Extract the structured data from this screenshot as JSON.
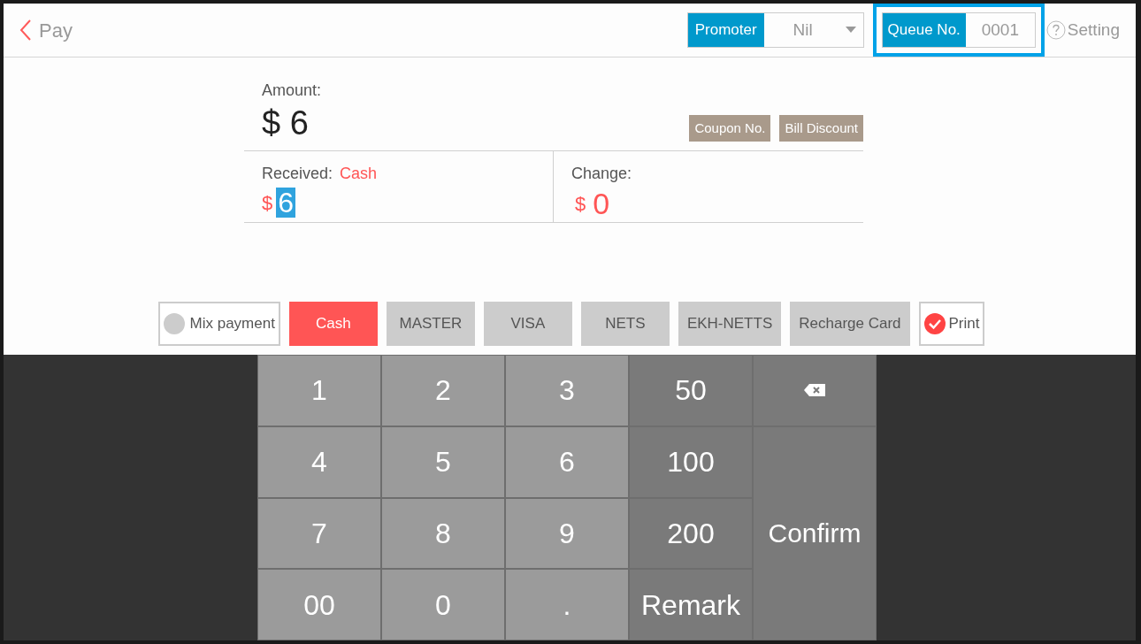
{
  "header": {
    "title": "Pay",
    "promoter": {
      "label": "Promoter",
      "value": "Nil"
    },
    "queue": {
      "label": "Queue No.",
      "value": "0001",
      "highlighted": true
    },
    "setting": "Setting"
  },
  "amount": {
    "label": "Amount:",
    "currency": "$",
    "value": "6"
  },
  "discount_buttons": [
    "Coupon No.",
    "Bill Discount"
  ],
  "received": {
    "label": "Received:",
    "method": "Cash",
    "currency": "$",
    "value": "6",
    "value_selected": true
  },
  "change": {
    "label": "Change:",
    "currency": "$",
    "value": "0"
  },
  "mix_payment": {
    "label": "Mix payment",
    "checked": false
  },
  "payment_methods": [
    {
      "label": "Cash",
      "selected": true
    },
    {
      "label": "MASTER",
      "selected": false
    },
    {
      "label": "VISA",
      "selected": false
    },
    {
      "label": "NETS",
      "selected": false
    },
    {
      "label": "EKH-NETTS",
      "selected": false
    },
    {
      "label": "Recharge Card",
      "selected": false
    }
  ],
  "print": {
    "label": "Print",
    "checked": true
  },
  "keypad": [
    {
      "kind": "digit",
      "label": "1"
    },
    {
      "kind": "digit",
      "label": "2"
    },
    {
      "kind": "digit",
      "label": "3"
    },
    {
      "kind": "quick",
      "label": "50"
    },
    {
      "kind": "backspace"
    },
    {
      "kind": "digit",
      "label": "4"
    },
    {
      "kind": "digit",
      "label": "5"
    },
    {
      "kind": "digit",
      "label": "6"
    },
    {
      "kind": "quick",
      "label": "100"
    },
    {
      "kind": "digit",
      "label": "7"
    },
    {
      "kind": "digit",
      "label": "8"
    },
    {
      "kind": "digit",
      "label": "9"
    },
    {
      "kind": "quick",
      "label": "200"
    },
    {
      "kind": "confirm",
      "label": "Confirm"
    },
    {
      "kind": "digit",
      "label": "00"
    },
    {
      "kind": "digit",
      "label": "0"
    },
    {
      "kind": "digit",
      "label": "."
    },
    {
      "kind": "quick",
      "label": "Remark"
    }
  ]
}
